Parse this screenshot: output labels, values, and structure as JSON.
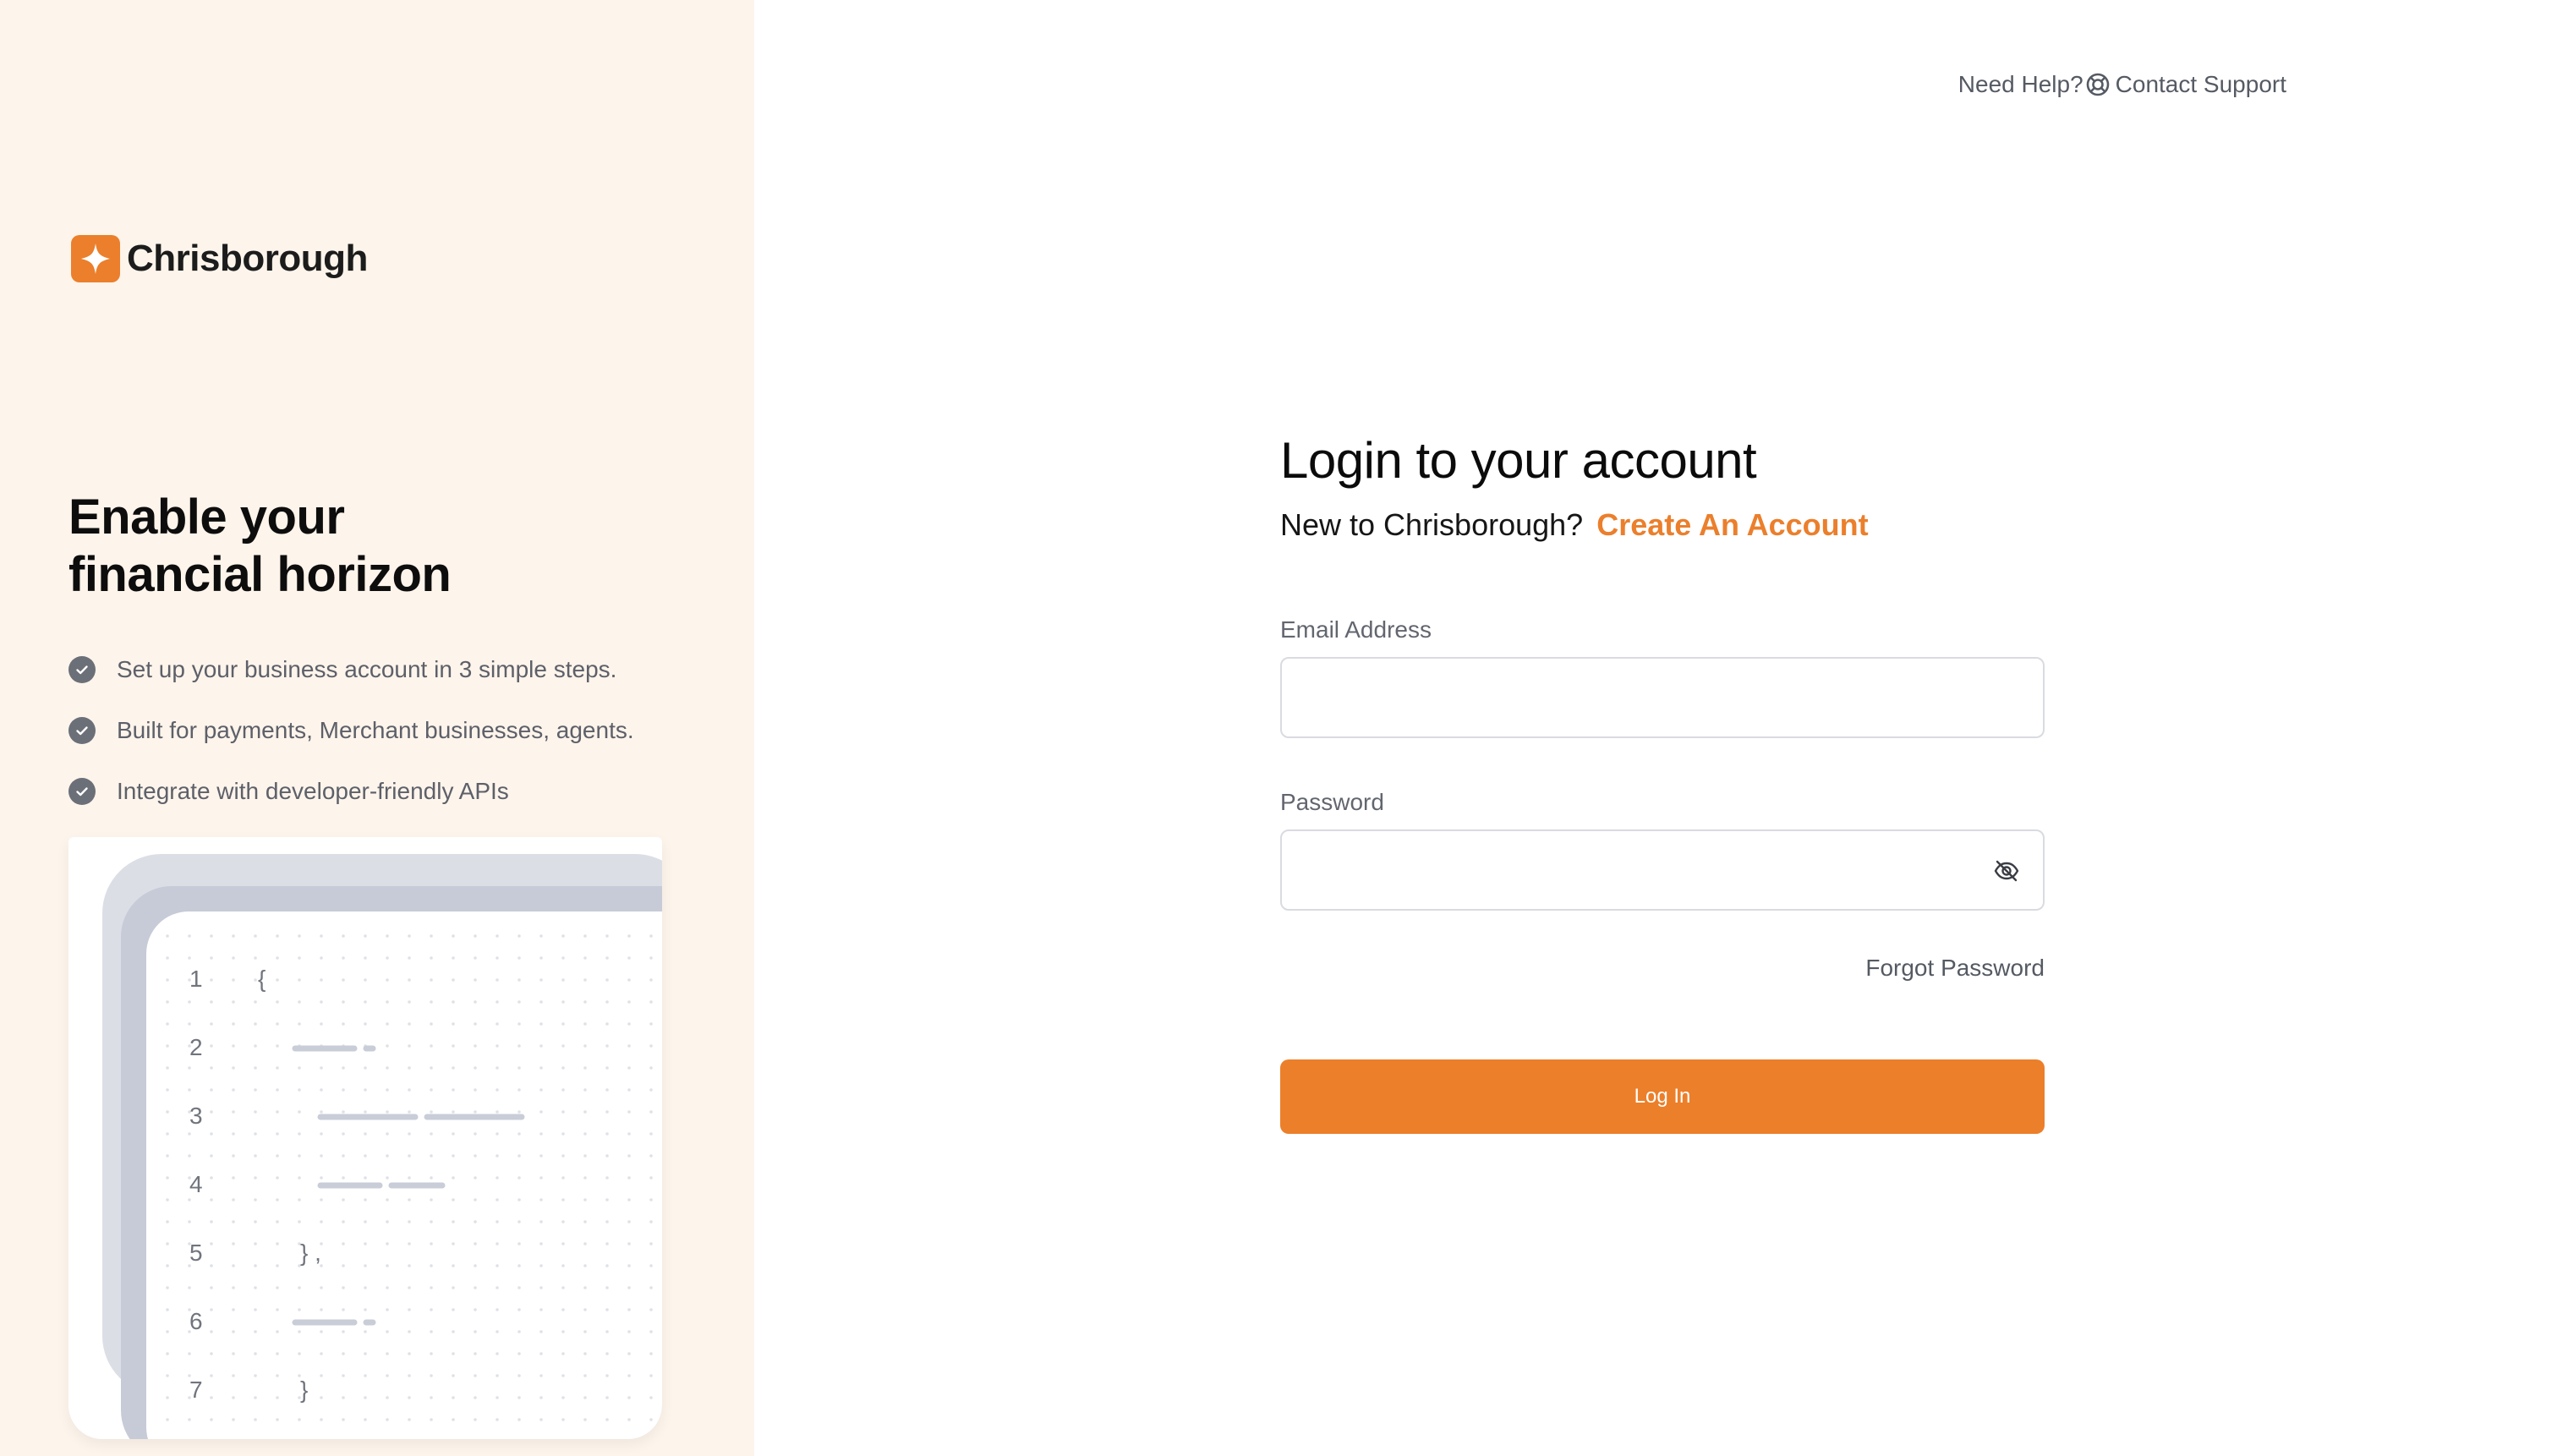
{
  "brand": {
    "name": "Chrisborough",
    "accent": "#eb7f2c",
    "panel_bg": "#fdf4eb"
  },
  "hero": {
    "headline_line1": "Enable your",
    "headline_line2": "financial horizon",
    "features": [
      "Set up your business account in 3 simple steps.",
      "Built for payments, Merchant businesses, agents.",
      "Integrate with developer-friendly APIs"
    ]
  },
  "code_illustration": {
    "line_numbers": [
      "1",
      "2",
      "3",
      "4",
      "5",
      "6",
      "7"
    ],
    "brace_open": "{",
    "brace_close_comma": "} ,",
    "brace_close": "}"
  },
  "help": {
    "label": "Need Help?",
    "icon": "lifebuoy-icon",
    "link": "Contact Support"
  },
  "login": {
    "title": "Login to your account",
    "subtitle": "New to Chrisborough?",
    "create_link": "Create An Account",
    "email_label": "Email Address",
    "email_value": "",
    "password_label": "Password",
    "password_value": "",
    "password_toggle_icon": "eye-off-icon",
    "forgot": "Forgot Password",
    "submit": "Log In"
  }
}
